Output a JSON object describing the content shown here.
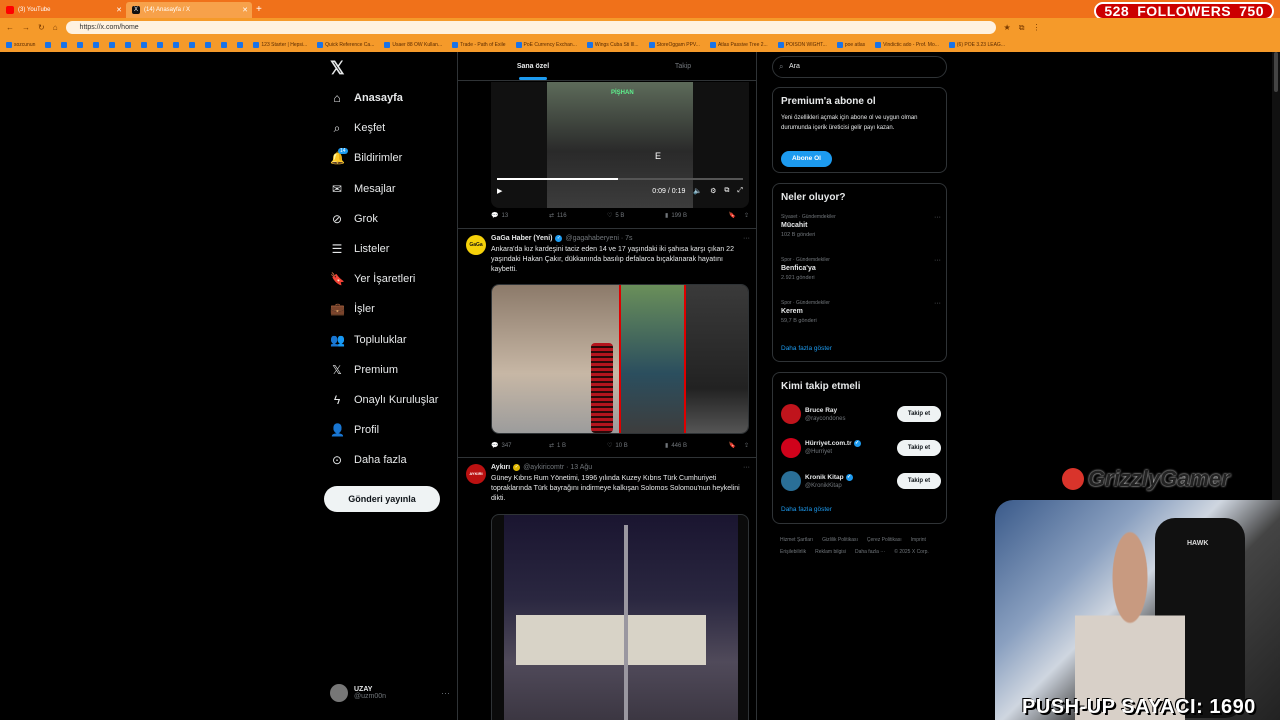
{
  "browser": {
    "tabs": [
      {
        "title": "(3) YouTube",
        "icon": "youtube-icon"
      },
      {
        "title": "(14) Anasayfa / X",
        "icon": "x-logo-icon"
      }
    ],
    "url": "https://x.com/home",
    "bookmarks": [
      "sozcunun",
      "",
      "",
      "",
      "",
      "",
      "",
      "",
      "",
      "",
      "",
      "",
      "",
      "",
      "123 Starter | Hepsi...",
      "Quick Reference Ca...",
      "Usaer 88 OW Kullan...",
      "Trade - Path of Exile",
      "PoE Currency Exchan...",
      "Wings Cuba Sti Ill...",
      "StoreOggam PPV...",
      "Atlas Passive Tree 2...",
      "POISON WIGHT...",
      "poe atlas",
      "Vindictic ado - Prof. Mo...",
      "(6) POE 3.23 LEAG..."
    ]
  },
  "followers": {
    "count": "528",
    "label": "FOLLOWERS",
    "goal": "750"
  },
  "nav": {
    "items": [
      {
        "label": "Anasayfa",
        "icon": "home-icon"
      },
      {
        "label": "Keşfet",
        "icon": "search-icon"
      },
      {
        "label": "Bildirimler",
        "icon": "bell-icon",
        "badge": "14"
      },
      {
        "label": "Mesajlar",
        "icon": "mail-icon"
      },
      {
        "label": "Grok",
        "icon": "grok-icon"
      },
      {
        "label": "Listeler",
        "icon": "list-icon"
      },
      {
        "label": "Yer İşaretleri",
        "icon": "bookmark-icon"
      },
      {
        "label": "İşler",
        "icon": "briefcase-icon"
      },
      {
        "label": "Topluluklar",
        "icon": "people-icon"
      },
      {
        "label": "Premium",
        "icon": "x-logo-icon"
      },
      {
        "label": "Onaylı Kuruluşlar",
        "icon": "lightning-icon"
      },
      {
        "label": "Profil",
        "icon": "person-icon"
      },
      {
        "label": "Daha fazla",
        "icon": "more-circle-icon"
      }
    ],
    "post_button": "Gönderi yayınla",
    "profile": {
      "name": "UZAY",
      "handle": "@uzm00n"
    }
  },
  "feed": {
    "tabs": [
      "Sana özel",
      "Takip"
    ],
    "video": {
      "time": "0:09 / 0:19",
      "progress": 0.49,
      "sign": "PİŞHAN",
      "caption": "E"
    },
    "post0_actions": {
      "reply": "13",
      "repost": "116",
      "like": "5 B",
      "views": "199 B"
    },
    "post1": {
      "name": "GaGa Haber (Yeni)",
      "handle": "@gagahaberyeni · 7s",
      "avatar_label": "GaGa",
      "text": "Ankara'da kız kardeşini taciz eden 14 ve 17 yaşındaki iki şahısa karşı çıkan 22 yaşındaki Hakan Çakır, dükkanında basılıp defalarca bıçaklanarak hayatını kaybetti.",
      "actions": {
        "reply": "347",
        "repost": "1 B",
        "like": "10 B",
        "views": "446 B"
      }
    },
    "post2": {
      "name": "Aykırı",
      "handle": "@aykiricomtr · 13 Ağu",
      "avatar_label": "AYKIRI",
      "text": "Güney Kıbrıs Rum Yönetimi, 1996 yılında Kuzey Kıbrıs Türk Cumhuriyeti topraklarında Türk bayrağını indirmeye kalkışan Solomos Solomou'nun heykelini dikti."
    }
  },
  "right": {
    "search_placeholder": "Ara",
    "premium": {
      "title": "Premium'a abone ol",
      "desc": "Yeni özellikleri açmak için abone ol ve uygun olman durumunda içerik üreticisi gelir payı kazan.",
      "button": "Abone Ol"
    },
    "trends": {
      "title": "Neler oluyor?",
      "items": [
        {
          "category": "Siyaset · Gündemdekiler",
          "topic": "Mücahit",
          "count": "102 B gönderi"
        },
        {
          "category": "Spor · Gündemdekiler",
          "topic": "Benfica'ya",
          "count": "2.921 gönderi"
        },
        {
          "category": "Spor · Gündemdekiler",
          "topic": "Kerem",
          "count": "59,7 B gönderi"
        }
      ],
      "show_more": "Daha fazla göster"
    },
    "who_to_follow": {
      "title": "Kimi takip etmeli",
      "items": [
        {
          "name": "Bruce Ray",
          "handle": "@raycondones",
          "verified": false,
          "color": "#c0141c"
        },
        {
          "name": "Hürriyet.com.tr",
          "handle": "@Hurriyet",
          "verified": true,
          "color": "#d0021b"
        },
        {
          "name": "Kronik Kitap",
          "handle": "@KronikKitap",
          "verified": true,
          "color": "#2a6f97"
        }
      ],
      "follow_label": "Takip et",
      "show_more": "Daha fazla göster"
    },
    "footer": [
      "Hizmet Şartları",
      "Gizlilik Politikası",
      "Çerez Politikası",
      "Imprint",
      "Erişilebilirlik",
      "Reklam bilgisi",
      "Daha fazla ···",
      "© 2025 X Corp."
    ]
  },
  "overlay": {
    "brand": "GrizzlyGamer",
    "chair_brand": "HAWK",
    "pushup": "PUSH-UP SAYACI: 1690"
  }
}
